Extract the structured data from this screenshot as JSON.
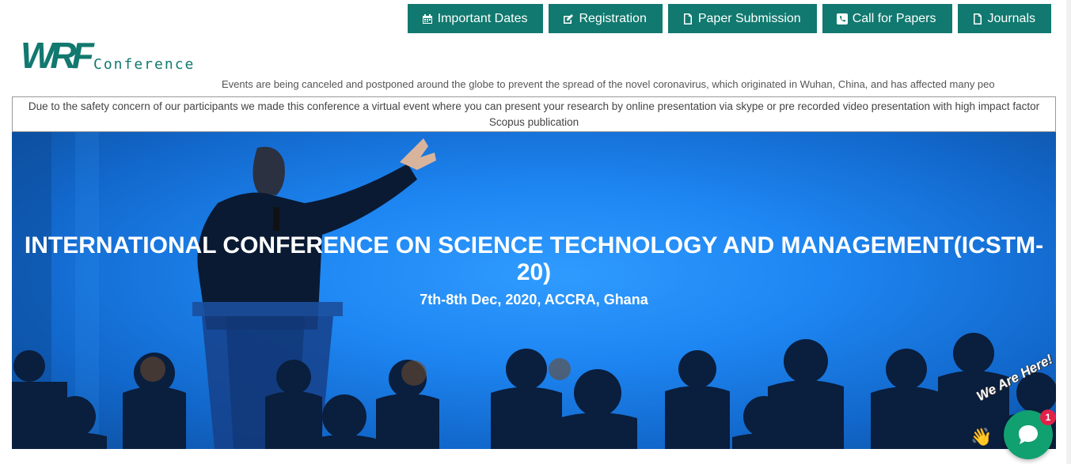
{
  "topnav": {
    "items": [
      {
        "label": "Important Dates",
        "icon": "calendar-icon"
      },
      {
        "label": "Registration",
        "icon": "edit-icon"
      },
      {
        "label": "Paper Submission",
        "icon": "file-icon"
      },
      {
        "label": "Call for Papers",
        "icon": "phone-icon"
      },
      {
        "label": "Journals",
        "icon": "file-icon"
      }
    ]
  },
  "logo": {
    "mark": "WRF",
    "sub": "Conference"
  },
  "ticker": {
    "text": "Events are being canceled and postponed around the globe to prevent the spread of the novel coronavirus, which originated in Wuhan, China, and has affected many peo"
  },
  "notice": {
    "text": "Due to the safety concern of our participants we made this conference a virtual event where you can present your research by online presentation via skype or pre recorded video presentation with high impact factor Scopus publication"
  },
  "hero": {
    "title": "INTERNATIONAL CONFERENCE ON SCIENCE TECHNOLOGY AND MANAGEMENT(ICSTM-20)",
    "subtitle": "7th-8th Dec, 2020, ACCRA, Ghana"
  },
  "chat": {
    "banner": "We Are Here!",
    "badge": "1",
    "icon": "chat-bubble-icon"
  },
  "colors": {
    "brand": "#11796f",
    "hero_blue": "#1e86f2",
    "chat_green": "#11a06f",
    "badge_red": "#e0224a"
  }
}
